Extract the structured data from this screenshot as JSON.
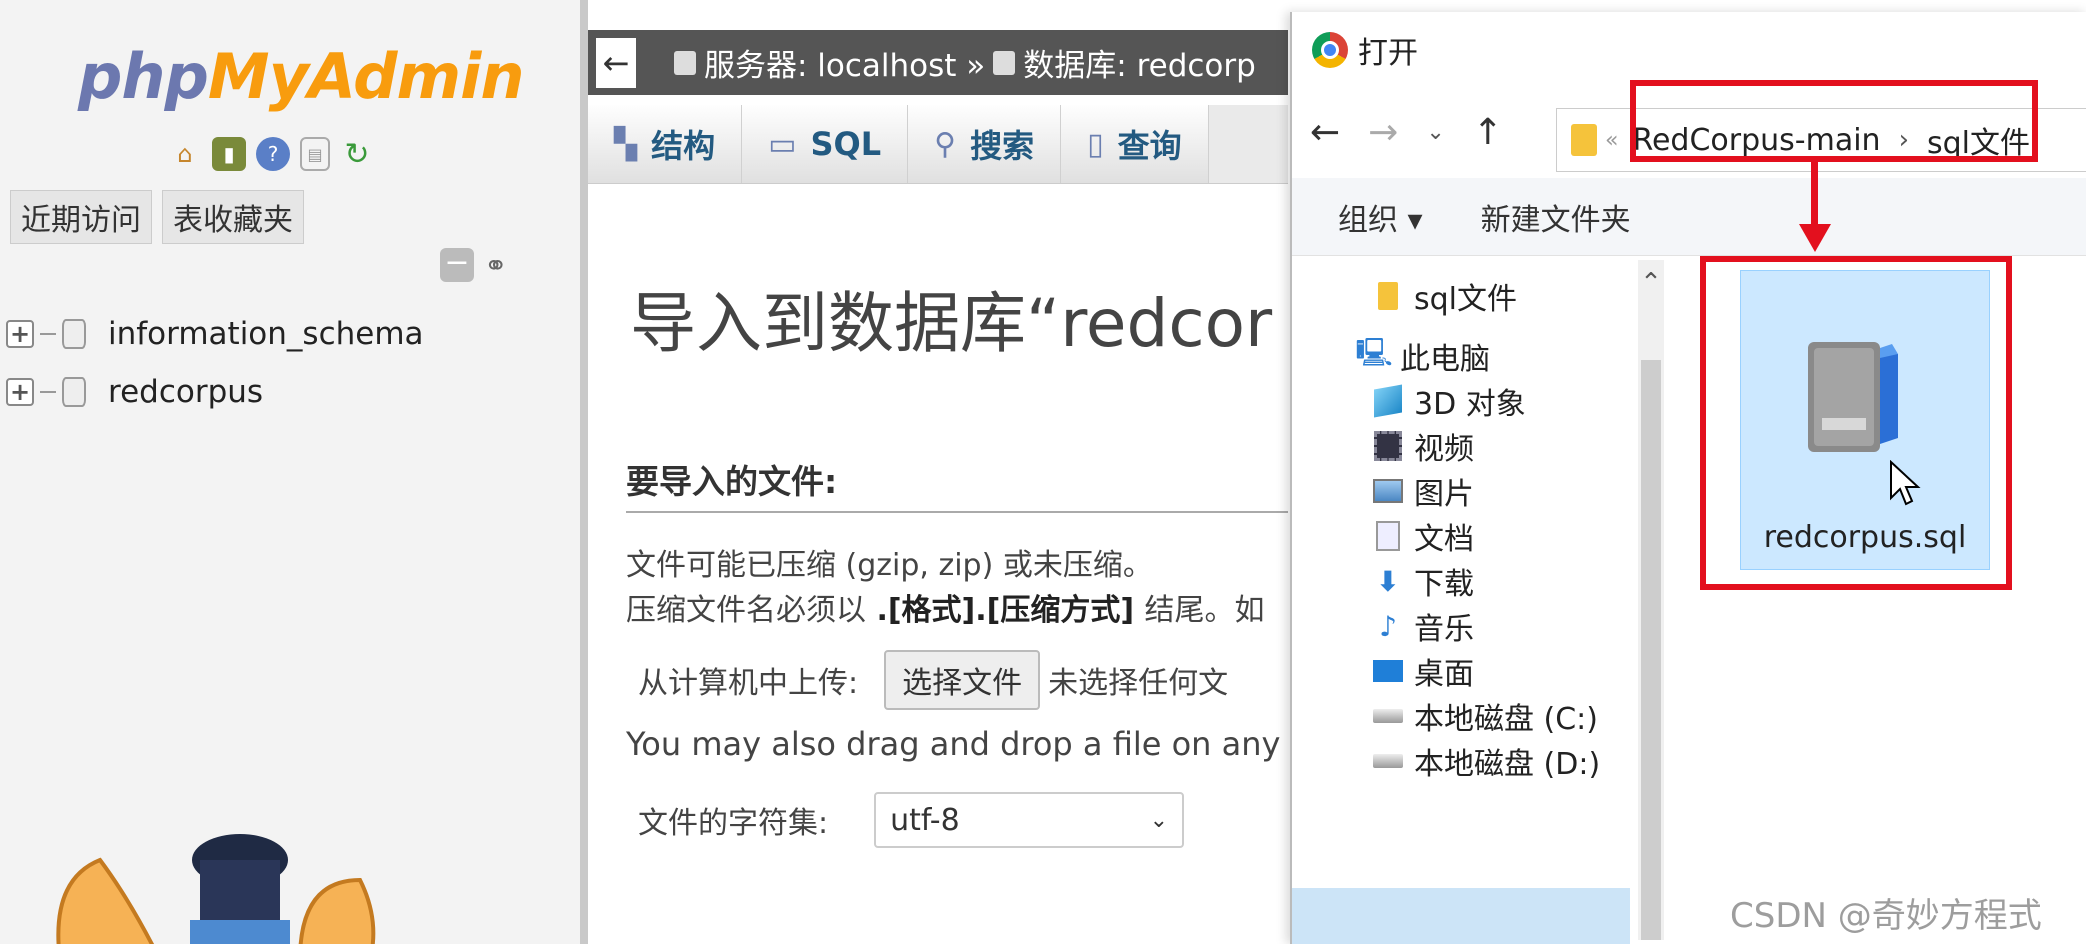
{
  "pma": {
    "logo_php": "php",
    "logo_myadmin": "MyAdmin",
    "tab_recent": "近期访问",
    "tab_favorites": "表收藏夹",
    "databases": [
      "information_schema",
      "redcorpus"
    ],
    "breadcrumb_server": "服务器: localhost »",
    "breadcrumb_db": "数据库: redcorp",
    "nav_tabs": [
      {
        "label": "结构",
        "icon": "structure-icon"
      },
      {
        "label": "SQL",
        "icon": "sql-icon"
      },
      {
        "label": "搜索",
        "icon": "search-icon"
      },
      {
        "label": "查询",
        "icon": "query-icon"
      }
    ],
    "page_title": "导入到数据库“redcor",
    "section_title": "要导入的文件:",
    "desc_line1": "文件可能已压缩 (gzip, zip) 或未压缩。",
    "desc_line2_pre": "压缩文件名必须以",
    "desc_line2_bold": " .[格式].[压缩方式] ",
    "desc_line2_post": "结尾。如",
    "upload_label": "从计算机中上传:",
    "choose_file_button": "选择文件",
    "no_file_text": "未选择任何文",
    "dragdrop_text": "You may also drag and drop a file on any p",
    "charset_label": "文件的字符集:",
    "charset_value": "utf-8"
  },
  "dialog": {
    "title": "打开",
    "address_path": [
      "RedCorpus-main",
      "sql文件"
    ],
    "organize_label": "组织 ▾",
    "new_folder_label": "新建文件夹",
    "nav_items": [
      {
        "label": "sql文件",
        "icon": "folder-icon"
      },
      {
        "label": "此电脑",
        "icon": "computer-icon"
      },
      {
        "label": "3D 对象",
        "icon": "cube-icon"
      },
      {
        "label": "视频",
        "icon": "video-icon"
      },
      {
        "label": "图片",
        "icon": "picture-icon"
      },
      {
        "label": "文档",
        "icon": "document-icon"
      },
      {
        "label": "下载",
        "icon": "download-icon"
      },
      {
        "label": "音乐",
        "icon": "music-icon"
      },
      {
        "label": "桌面",
        "icon": "desktop-icon"
      },
      {
        "label": "本地磁盘 (C:)",
        "icon": "drive-icon"
      },
      {
        "label": "本地磁盘 (D:)",
        "icon": "drive-icon"
      }
    ],
    "selected_file": "redcorpus.sql"
  },
  "watermark": "CSDN @奇妙方程式",
  "colors": {
    "highlight_red": "#e3101e",
    "selection_blue": "#cce8ff",
    "pma_orange": "#f89c0e",
    "pma_blue": "#6c78af"
  }
}
